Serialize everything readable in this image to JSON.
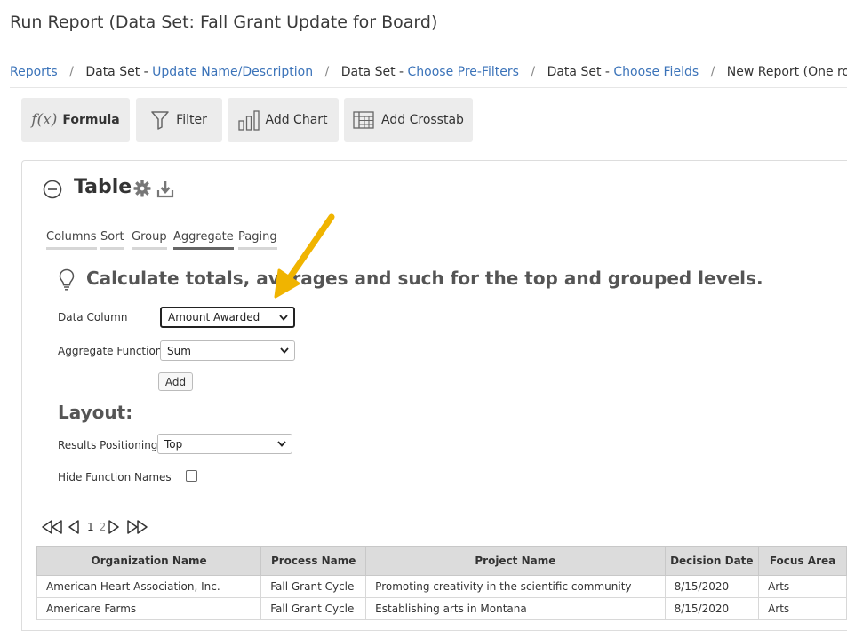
{
  "page": {
    "title": "Run Report (Data Set: Fall Grant Update for Board)"
  },
  "breadcrumb": {
    "reports": "Reports",
    "dataset_prefix": "Data Set - ",
    "step1": "Update Name/Description",
    "step2": "Choose Pre-Filters",
    "step3": "Choose Fields",
    "current": "New Report (One row"
  },
  "toolbar": {
    "formula_fx": "f(x)",
    "formula": "Formula",
    "filter": "Filter",
    "chart": "Add Chart",
    "crosstab": "Add Crosstab"
  },
  "table_section": {
    "title": "Table",
    "subtabs": [
      "Columns",
      "Sort",
      "Group",
      "Aggregate",
      "Paging"
    ],
    "active_subtab": "Aggregate",
    "hint": "Calculate totals, averages and such for the top and grouped levels."
  },
  "aggregate_form": {
    "data_column_label": "Data Column",
    "data_column_value": "Amount Awarded",
    "function_label": "Aggregate Function",
    "function_value": "Sum",
    "add_label": "Add"
  },
  "layout_form": {
    "title": "Layout:",
    "positioning_label": "Results Positioning",
    "positioning_value": "Top",
    "hide_names_label": "Hide Function Names"
  },
  "pager": {
    "current": "1",
    "next": "2"
  },
  "grid": {
    "headers": [
      "Organization Name",
      "Process Name",
      "Project Name",
      "Decision Date",
      "Focus Area"
    ],
    "rows": [
      [
        "American Heart Association, Inc.",
        "Fall Grant Cycle",
        "Promoting creativity in the scientific community",
        "8/15/2020",
        "Arts"
      ],
      [
        "Americare Farms",
        "Fall Grant Cycle",
        "Establishing arts in Montana",
        "8/15/2020",
        "Arts"
      ]
    ]
  },
  "colors": {
    "link": "#3b73b9",
    "arrow": "#f0b400",
    "header_bg": "#dcdcdc",
    "button_bg": "#ececec"
  }
}
